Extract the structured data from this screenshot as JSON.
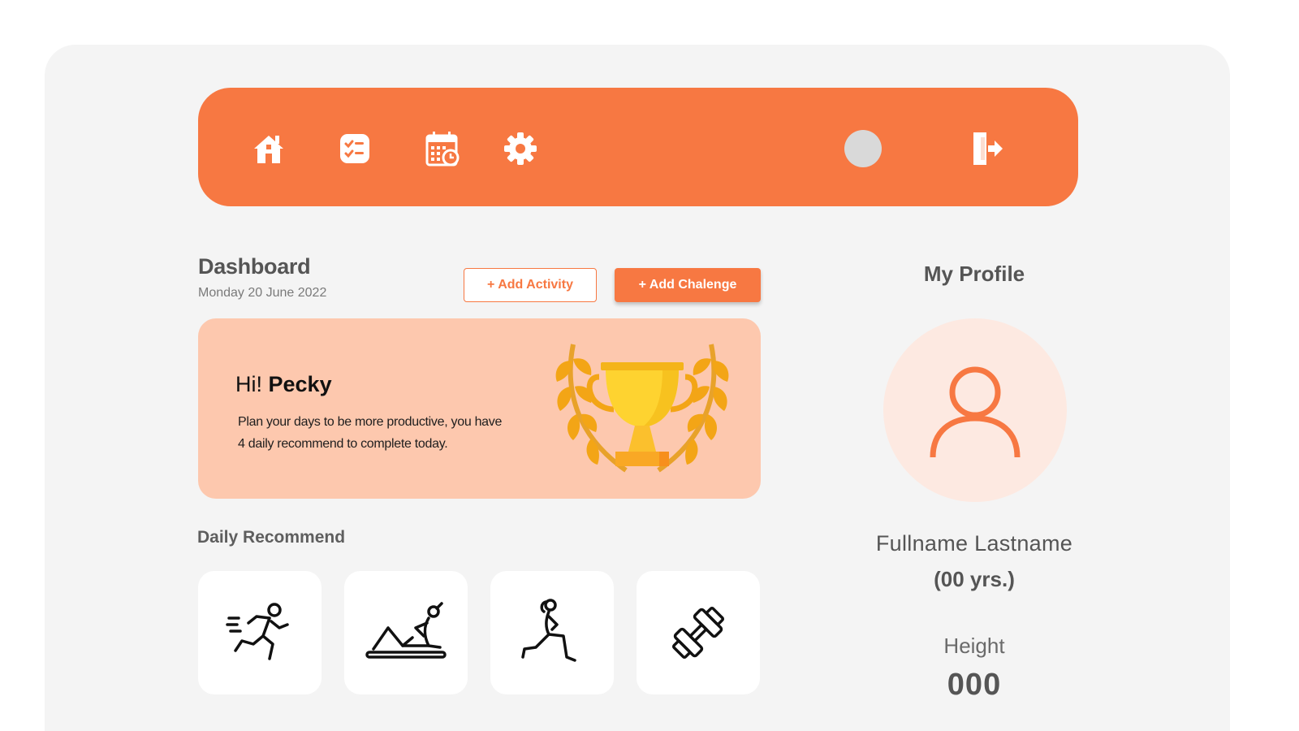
{
  "colors": {
    "accent": "#f77842",
    "banner": "#fdc8ae",
    "background": "#f4f4f4",
    "profile_circle": "#fde9e1"
  },
  "nav": {
    "icons": [
      "home-icon",
      "checklist-icon",
      "calendar-clock-icon",
      "gear-icon",
      "logout-icon"
    ]
  },
  "dashboard": {
    "title": "Dashboard",
    "date": "Monday 20 June 2022",
    "add_activity_label": "+ Add Activity",
    "add_challenge_label": "+ Add Chalenge"
  },
  "banner": {
    "greeting": "Hi!",
    "name": "Pecky",
    "line1": "Plan your days to be more productive, you have",
    "line2": "4 daily recommend to complete today.",
    "icon": "trophy-icon"
  },
  "daily": {
    "title": "Daily Recommend",
    "items": [
      {
        "icon": "running-icon"
      },
      {
        "icon": "situp-icon"
      },
      {
        "icon": "lunge-icon"
      },
      {
        "icon": "dumbbell-icon"
      }
    ]
  },
  "profile": {
    "title": "My Profile",
    "name": "Fullname Lastname",
    "age": "(00 yrs.)",
    "height_label": "Height",
    "height_value": "000"
  }
}
